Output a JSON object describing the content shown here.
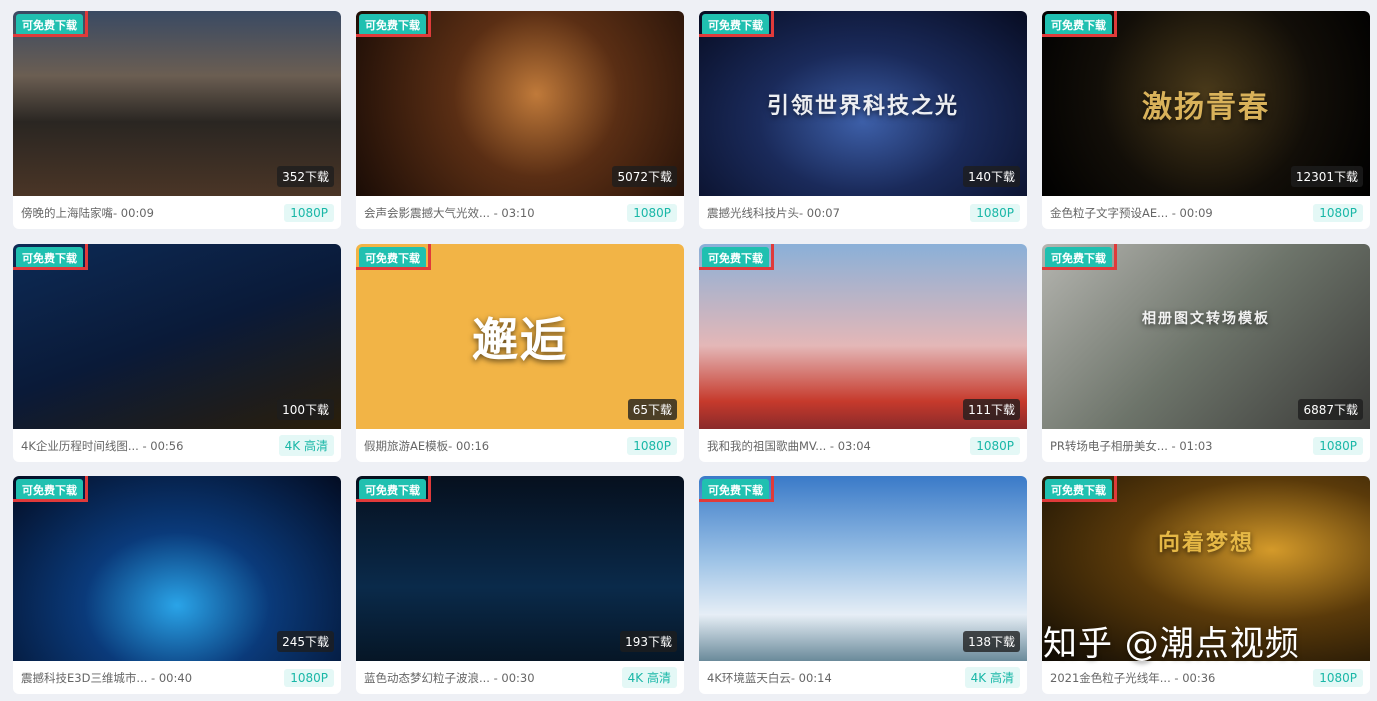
{
  "cards": [
    {
      "badge": "可免费下载",
      "downloads": "352下载",
      "caption": "",
      "title": "傍晚的上海陆家嘴- 00:09",
      "quality": "1080P"
    },
    {
      "badge": "可免费下载",
      "downloads": "5072下载",
      "caption": "",
      "title": "会声会影震撼大气光效... - 03:10",
      "quality": "1080P"
    },
    {
      "badge": "可免费下载",
      "downloads": "140下载",
      "caption": "引领世界科技之光",
      "title": "震撼光线科技片头- 00:07",
      "quality": "1080P"
    },
    {
      "badge": "可免费下载",
      "downloads": "12301下载",
      "caption": "激扬青春",
      "title": "金色粒子文字预设AE... - 00:09",
      "quality": "1080P"
    },
    {
      "badge": "可免费下载",
      "downloads": "100下载",
      "caption": "",
      "title": "4K企业历程时间线图... - 00:56",
      "quality": "4K 高清"
    },
    {
      "badge": "可免费下载",
      "downloads": "65下载",
      "caption": "邂逅",
      "title": "假期旅游AE模板- 00:16",
      "quality": "1080P"
    },
    {
      "badge": "可免费下载",
      "downloads": "111下载",
      "caption": "",
      "title": "我和我的祖国歌曲MV... - 03:04",
      "quality": "1080P"
    },
    {
      "badge": "可免费下载",
      "downloads": "6887下载",
      "caption": "相册图文转场模板",
      "title": "PR转场电子相册美女... - 01:03",
      "quality": "1080P"
    },
    {
      "badge": "可免费下载",
      "downloads": "245下载",
      "caption": "",
      "title": "震撼科技E3D三维城市... - 00:40",
      "quality": "1080P"
    },
    {
      "badge": "可免费下载",
      "downloads": "193下载",
      "caption": "",
      "title": "蓝色动态梦幻粒子波浪... - 00:30",
      "quality": "4K 高清"
    },
    {
      "badge": "可免费下载",
      "downloads": "138下载",
      "caption": "",
      "title": "4K环境蓝天白云- 00:14",
      "quality": "4K 高清"
    },
    {
      "badge": "可免费下载",
      "downloads": "",
      "caption": "向着梦想",
      "title": "2021金色粒子光线年... - 00:36",
      "quality": "1080P"
    }
  ],
  "watermark": "知乎 @潮点视频"
}
